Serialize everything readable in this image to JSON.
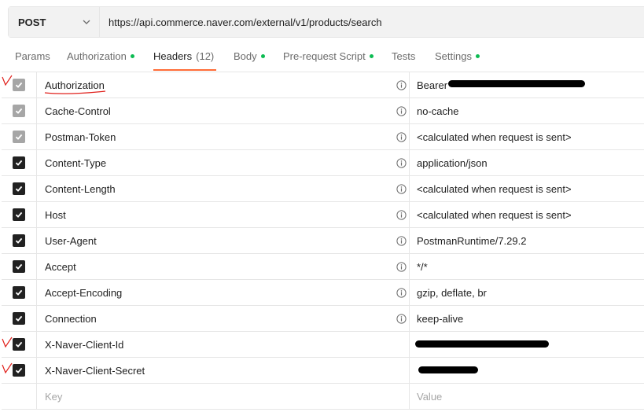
{
  "request": {
    "method": "POST",
    "url": "https://api.commerce.naver.com/external/v1/products/search"
  },
  "tabs": [
    {
      "label": "Params",
      "dot": false,
      "active": false
    },
    {
      "label": "Authorization",
      "dot": true,
      "active": false
    },
    {
      "label": "Headers",
      "count": "(12)",
      "dot": false,
      "active": true
    },
    {
      "label": "Body",
      "dot": true,
      "active": false
    },
    {
      "label": "Pre-request Script",
      "dot": true,
      "active": false
    },
    {
      "label": "Tests",
      "dot": false,
      "active": false
    },
    {
      "label": "Settings",
      "dot": true,
      "active": false
    }
  ],
  "headers": [
    {
      "key": "Authorization",
      "value": "Bearer",
      "checked": true,
      "disabled": true,
      "info": true
    },
    {
      "key": "Cache-Control",
      "value": "no-cache",
      "checked": true,
      "disabled": true,
      "info": true
    },
    {
      "key": "Postman-Token",
      "value": "<calculated when request is sent>",
      "checked": true,
      "disabled": true,
      "info": true
    },
    {
      "key": "Content-Type",
      "value": "application/json",
      "checked": true,
      "disabled": false,
      "info": true
    },
    {
      "key": "Content-Length",
      "value": "<calculated when request is sent>",
      "checked": true,
      "disabled": false,
      "info": true
    },
    {
      "key": "Host",
      "value": "<calculated when request is sent>",
      "checked": true,
      "disabled": false,
      "info": true
    },
    {
      "key": "User-Agent",
      "value": "PostmanRuntime/7.29.2",
      "checked": true,
      "disabled": false,
      "info": true
    },
    {
      "key": "Accept",
      "value": "*/*",
      "checked": true,
      "disabled": false,
      "info": true
    },
    {
      "key": "Accept-Encoding",
      "value": "gzip, deflate, br",
      "checked": true,
      "disabled": false,
      "info": true
    },
    {
      "key": "Connection",
      "value": "keep-alive",
      "checked": true,
      "disabled": false,
      "info": true
    },
    {
      "key": "X-Naver-Client-Id",
      "value": "",
      "checked": true,
      "disabled": false,
      "info": false
    },
    {
      "key": "X-Naver-Client-Secret",
      "value": "",
      "checked": true,
      "disabled": false,
      "info": false
    }
  ],
  "new_row": {
    "key_placeholder": "Key",
    "value_placeholder": "Value"
  },
  "colors": {
    "accent": "#ff6c37",
    "dot": "#0cbb52",
    "annotation": "#e0201b"
  }
}
